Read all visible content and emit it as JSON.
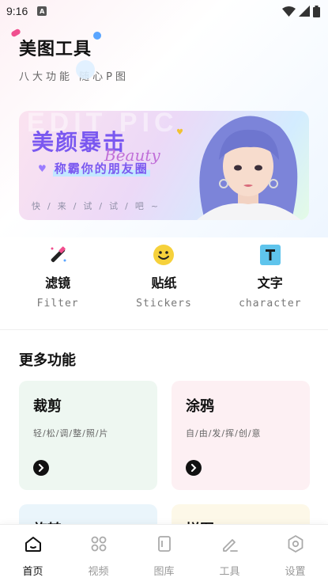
{
  "status_bar": {
    "time": "9:16",
    "notification_letter": "A"
  },
  "header": {
    "title": "美图工具",
    "subtitle": "八大功能 随心P图"
  },
  "banner": {
    "watermark": "EDIT PIC",
    "headline": "美颜暴击",
    "script": "Beauty",
    "slogan": "称霸你的朋友圈",
    "hint": "快/来/试/试/吧~"
  },
  "tools": [
    {
      "name": "滤镜",
      "sub": "Filter",
      "icon": "magic-wand-icon"
    },
    {
      "name": "贴纸",
      "sub": "Stickers",
      "icon": "smiley-icon"
    },
    {
      "name": "文字",
      "sub": "character",
      "icon": "text-icon"
    }
  ],
  "more": {
    "title": "更多功能",
    "cards": [
      {
        "title": "裁剪",
        "desc": "轻/松/调/整/照/片",
        "color": "#eef7f1"
      },
      {
        "title": "涂鸦",
        "desc": "自/由/发/挥/创/意",
        "color": "#fdf0f3"
      },
      {
        "title": "旋转",
        "desc": "",
        "color": "#eaf5fb"
      },
      {
        "title": "拼图",
        "desc": "",
        "color": "#fdf8e8"
      }
    ]
  },
  "nav": {
    "items": [
      {
        "label": "首页",
        "icon": "home-icon",
        "active": true
      },
      {
        "label": "视频",
        "icon": "grid-icon",
        "active": false
      },
      {
        "label": "图库",
        "icon": "gallery-icon",
        "active": false
      },
      {
        "label": "工具",
        "icon": "edit-icon",
        "active": false
      },
      {
        "label": "设置",
        "icon": "settings-icon",
        "active": false
      }
    ]
  },
  "colors": {
    "accent_purple": "#7a58f0",
    "deco_pink": "#f04f8f",
    "deco_blue": "#5aa5ff",
    "sticker_yellow": "#f6d13b",
    "text_icon_blue": "#5fc4ec"
  }
}
